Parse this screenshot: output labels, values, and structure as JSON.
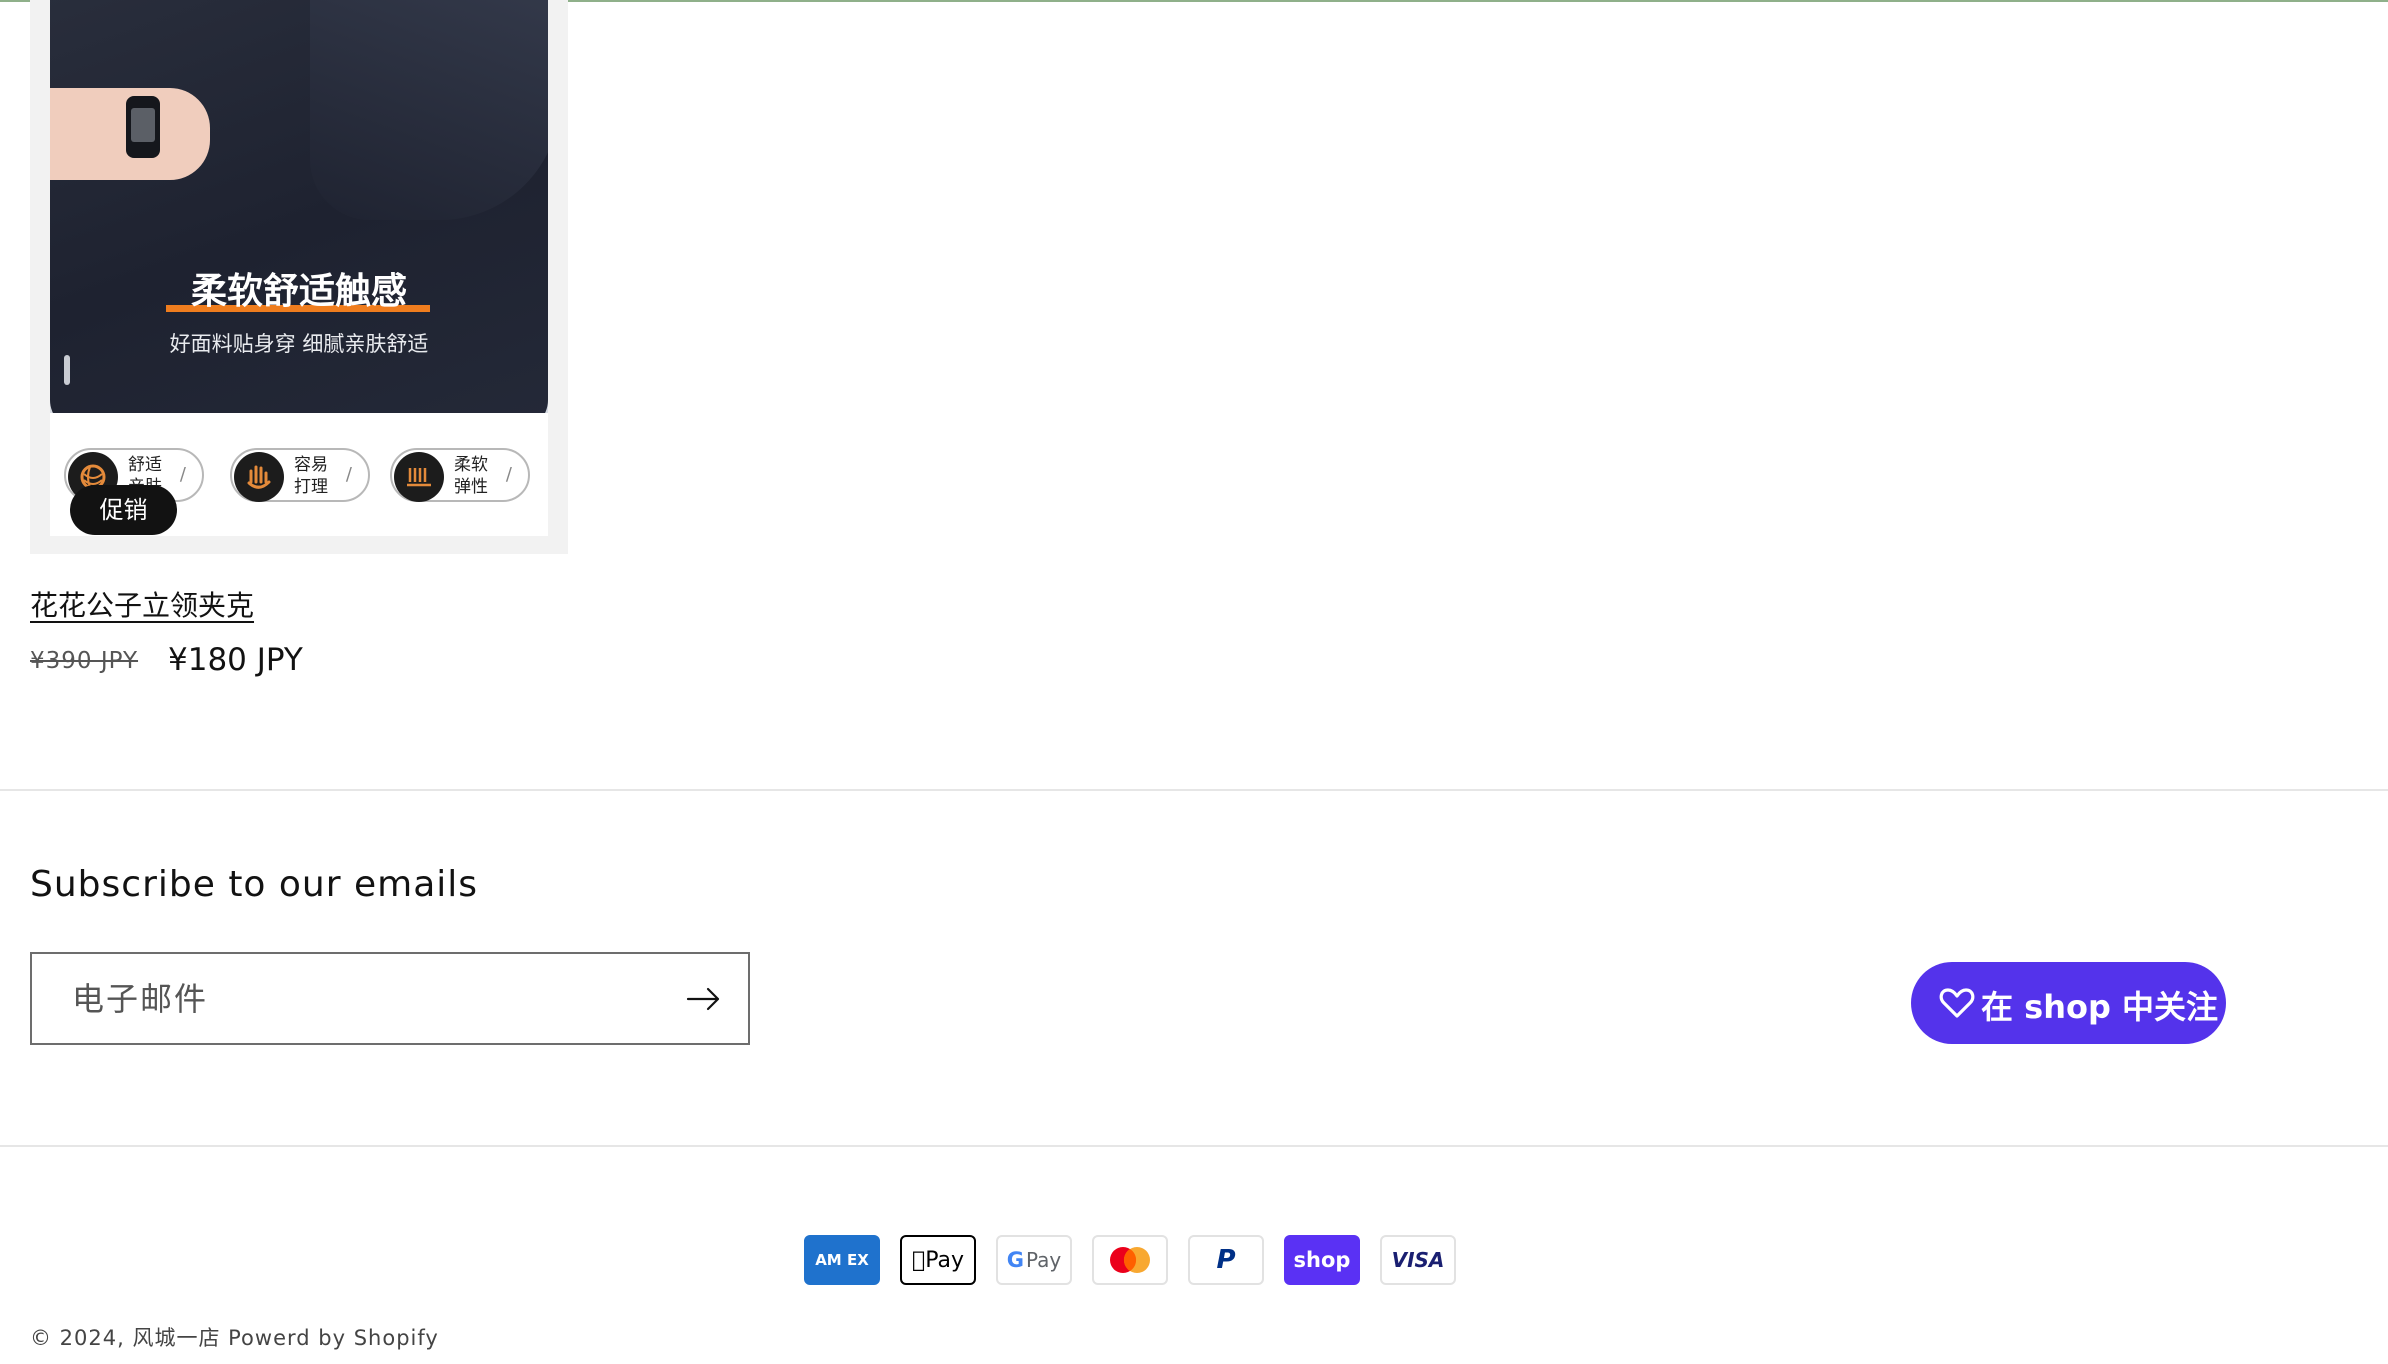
{
  "product": {
    "promo_title": "柔软舒适触感",
    "promo_subtitle": "好面料贴身穿 细腻亲肤舒适",
    "features": [
      {
        "line1": "舒适",
        "line2": "亲肤",
        "icon": "yarn-ball-icon"
      },
      {
        "line1": "容易",
        "line2": "打理",
        "icon": "hand-icon"
      },
      {
        "line1": "柔软",
        "line2": "弹性",
        "icon": "fiber-icon"
      }
    ],
    "badge": "促销",
    "title": "花花公子立领夹克",
    "price_original": "¥390 JPY",
    "price_sale": "¥180 JPY"
  },
  "subscribe": {
    "heading": "Subscribe to our emails",
    "email_placeholder": "电子邮件",
    "submit_icon": "arrow-right-icon"
  },
  "shop_follow": {
    "label": "在 shop 中关注",
    "icon": "heart-icon",
    "color": "#5433eb"
  },
  "payments": [
    {
      "name": "American Express",
      "text": "AM EX",
      "color": "#1f72cd"
    },
    {
      "name": "Apple Pay",
      "text": "Pay",
      "color": "#000000"
    },
    {
      "name": "Google Pay",
      "text": "Pay",
      "color": "#5f6368"
    },
    {
      "name": "Mastercard",
      "text": "",
      "color": "#eb001b"
    },
    {
      "name": "PayPal",
      "text": "P",
      "color": "#003087"
    },
    {
      "name": "Shop Pay",
      "text": "shop",
      "color": "#5a31f4"
    },
    {
      "name": "Visa",
      "text": "VISA",
      "color": "#1a1f71"
    }
  ],
  "footer": {
    "copyright": "© 2024, 风城一店 Powerd by Shopify"
  }
}
